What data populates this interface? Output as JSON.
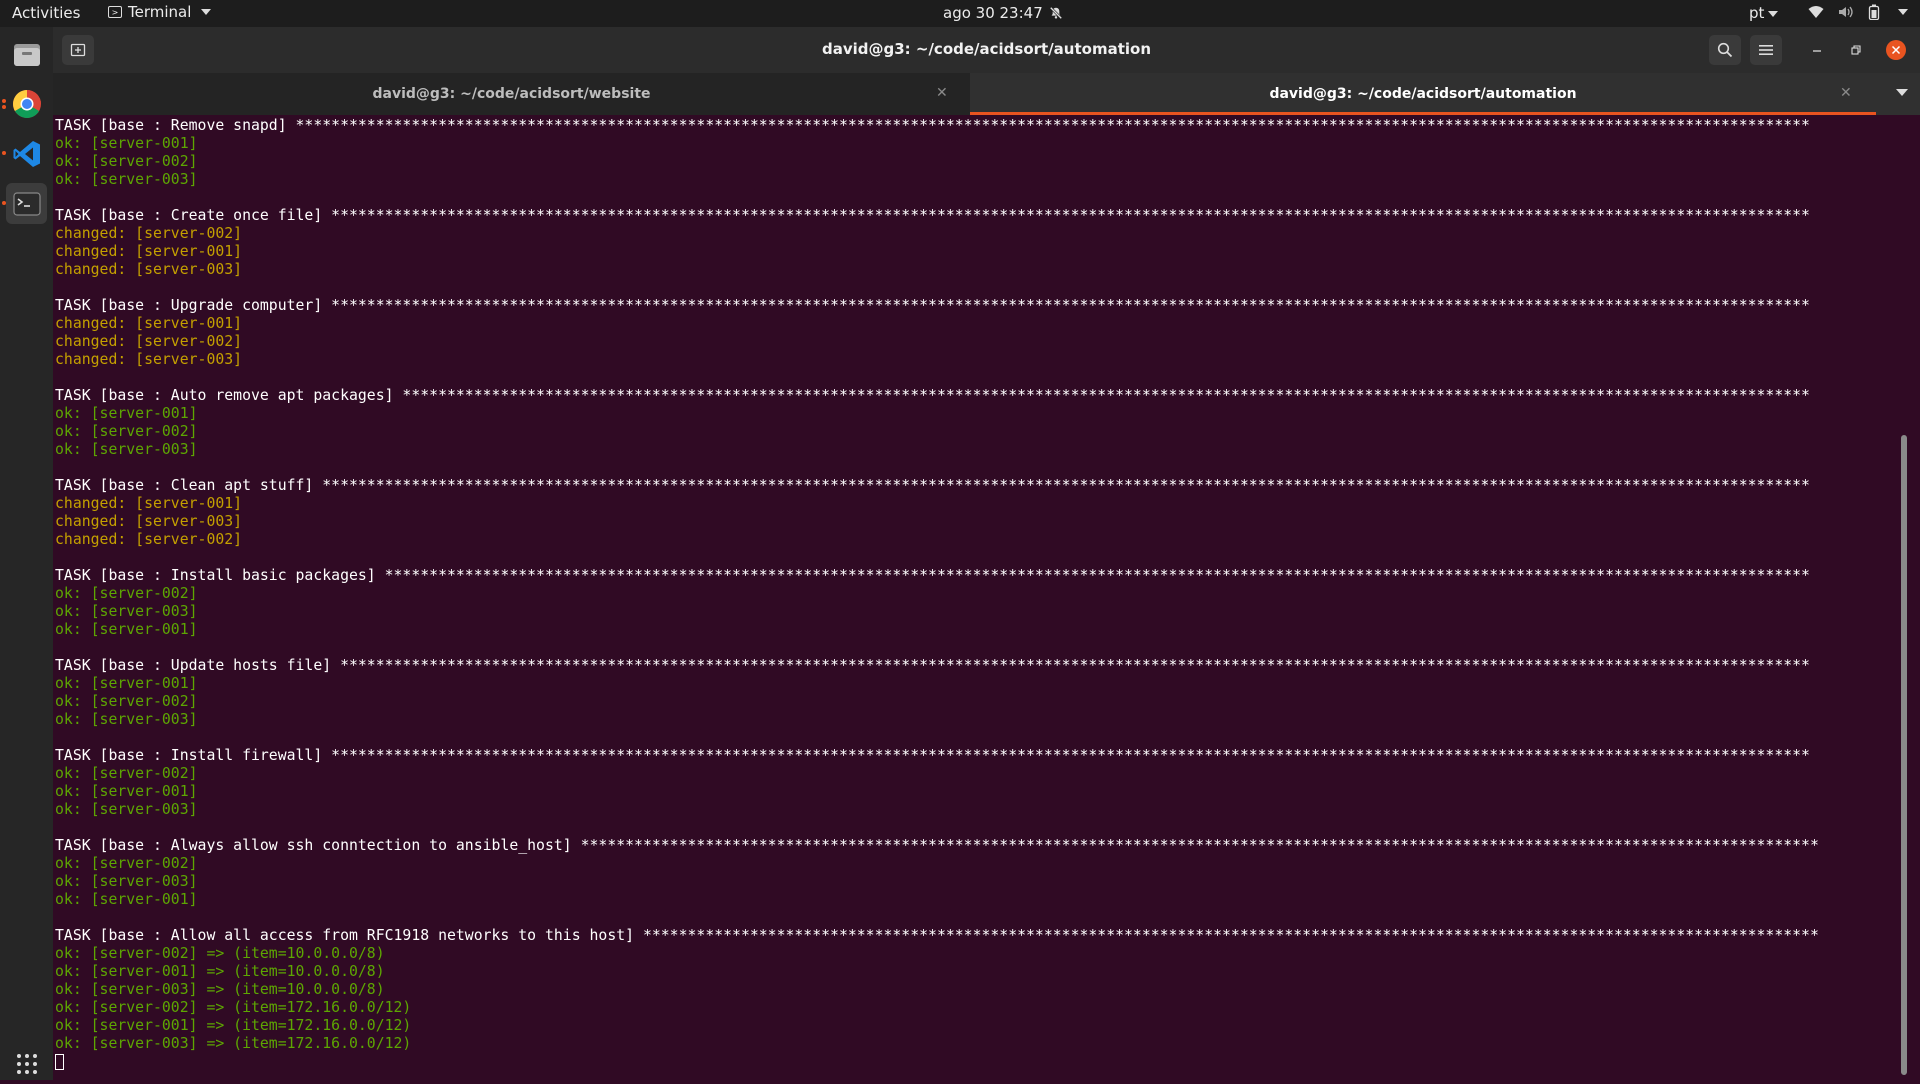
{
  "topbar": {
    "activities": "Activities",
    "app_name": "Terminal",
    "clock": "ago 30  23:47",
    "lang": "pt"
  },
  "window": {
    "title": "david@g3: ~/code/acidsort/automation"
  },
  "tabs": [
    {
      "label": "david@g3: ~/code/acidsort/website",
      "active": false
    },
    {
      "label": "david@g3: ~/code/acidsort/automation",
      "active": true
    }
  ],
  "colors": {
    "terminal_bg": "#300a24",
    "ok": "#5da602",
    "changed": "#c4a000",
    "accent": "#e95420"
  },
  "icons": {
    "dock": [
      "files-icon",
      "chrome-icon",
      "vscode-icon",
      "terminal-icon",
      "app-grid-icon"
    ],
    "tray": [
      "wifi-icon",
      "volume-icon",
      "battery-icon"
    ]
  },
  "terminal": {
    "lines": [
      {
        "type": "task",
        "text": "TASK [base : Remove snapd] **************************************************************************************************************************************************************************"
      },
      {
        "type": "ok",
        "text": "ok: [server-001]"
      },
      {
        "type": "ok",
        "text": "ok: [server-002]"
      },
      {
        "type": "ok",
        "text": "ok: [server-003]"
      },
      {
        "type": "blank",
        "text": ""
      },
      {
        "type": "task",
        "text": "TASK [base : Create once file] **********************************************************************************************************************************************************************"
      },
      {
        "type": "changed",
        "text": "changed: [server-002]"
      },
      {
        "type": "changed",
        "text": "changed: [server-001]"
      },
      {
        "type": "changed",
        "text": "changed: [server-003]"
      },
      {
        "type": "blank",
        "text": ""
      },
      {
        "type": "task",
        "text": "TASK [base : Upgrade computer] **********************************************************************************************************************************************************************"
      },
      {
        "type": "changed",
        "text": "changed: [server-001]"
      },
      {
        "type": "changed",
        "text": "changed: [server-002]"
      },
      {
        "type": "changed",
        "text": "changed: [server-003]"
      },
      {
        "type": "blank",
        "text": ""
      },
      {
        "type": "task",
        "text": "TASK [base : Auto remove apt packages] **************************************************************************************************************************************************************"
      },
      {
        "type": "ok",
        "text": "ok: [server-001]"
      },
      {
        "type": "ok",
        "text": "ok: [server-002]"
      },
      {
        "type": "ok",
        "text": "ok: [server-003]"
      },
      {
        "type": "blank",
        "text": ""
      },
      {
        "type": "task",
        "text": "TASK [base : Clean apt stuff] ***********************************************************************************************************************************************************************"
      },
      {
        "type": "changed",
        "text": "changed: [server-001]"
      },
      {
        "type": "changed",
        "text": "changed: [server-003]"
      },
      {
        "type": "changed",
        "text": "changed: [server-002]"
      },
      {
        "type": "blank",
        "text": ""
      },
      {
        "type": "task",
        "text": "TASK [base : Install basic packages] ****************************************************************************************************************************************************************"
      },
      {
        "type": "ok",
        "text": "ok: [server-002]"
      },
      {
        "type": "ok",
        "text": "ok: [server-003]"
      },
      {
        "type": "ok",
        "text": "ok: [server-001]"
      },
      {
        "type": "blank",
        "text": ""
      },
      {
        "type": "task",
        "text": "TASK [base : Update hosts file] *********************************************************************************************************************************************************************"
      },
      {
        "type": "ok",
        "text": "ok: [server-001]"
      },
      {
        "type": "ok",
        "text": "ok: [server-002]"
      },
      {
        "type": "ok",
        "text": "ok: [server-003]"
      },
      {
        "type": "blank",
        "text": ""
      },
      {
        "type": "task",
        "text": "TASK [base : Install firewall] **********************************************************************************************************************************************************************"
      },
      {
        "type": "ok",
        "text": "ok: [server-002]"
      },
      {
        "type": "ok",
        "text": "ok: [server-001]"
      },
      {
        "type": "ok",
        "text": "ok: [server-003]"
      },
      {
        "type": "blank",
        "text": ""
      },
      {
        "type": "task",
        "text": "TASK [base : Always allow ssh conntection to ansible_host] *******************************************************************************************************************************************"
      },
      {
        "type": "ok",
        "text": "ok: [server-002]"
      },
      {
        "type": "ok",
        "text": "ok: [server-003]"
      },
      {
        "type": "ok",
        "text": "ok: [server-001]"
      },
      {
        "type": "blank",
        "text": ""
      },
      {
        "type": "task",
        "text": "TASK [base : Allow all access from RFC1918 networks to this host] ************************************************************************************************************************************"
      },
      {
        "type": "ok",
        "text": "ok: [server-002] => (item=10.0.0.0/8)"
      },
      {
        "type": "ok",
        "text": "ok: [server-001] => (item=10.0.0.0/8)"
      },
      {
        "type": "ok",
        "text": "ok: [server-003] => (item=10.0.0.0/8)"
      },
      {
        "type": "ok",
        "text": "ok: [server-002] => (item=172.16.0.0/12)"
      },
      {
        "type": "ok",
        "text": "ok: [server-001] => (item=172.16.0.0/12)"
      },
      {
        "type": "ok",
        "text": "ok: [server-003] => (item=172.16.0.0/12)"
      }
    ]
  }
}
